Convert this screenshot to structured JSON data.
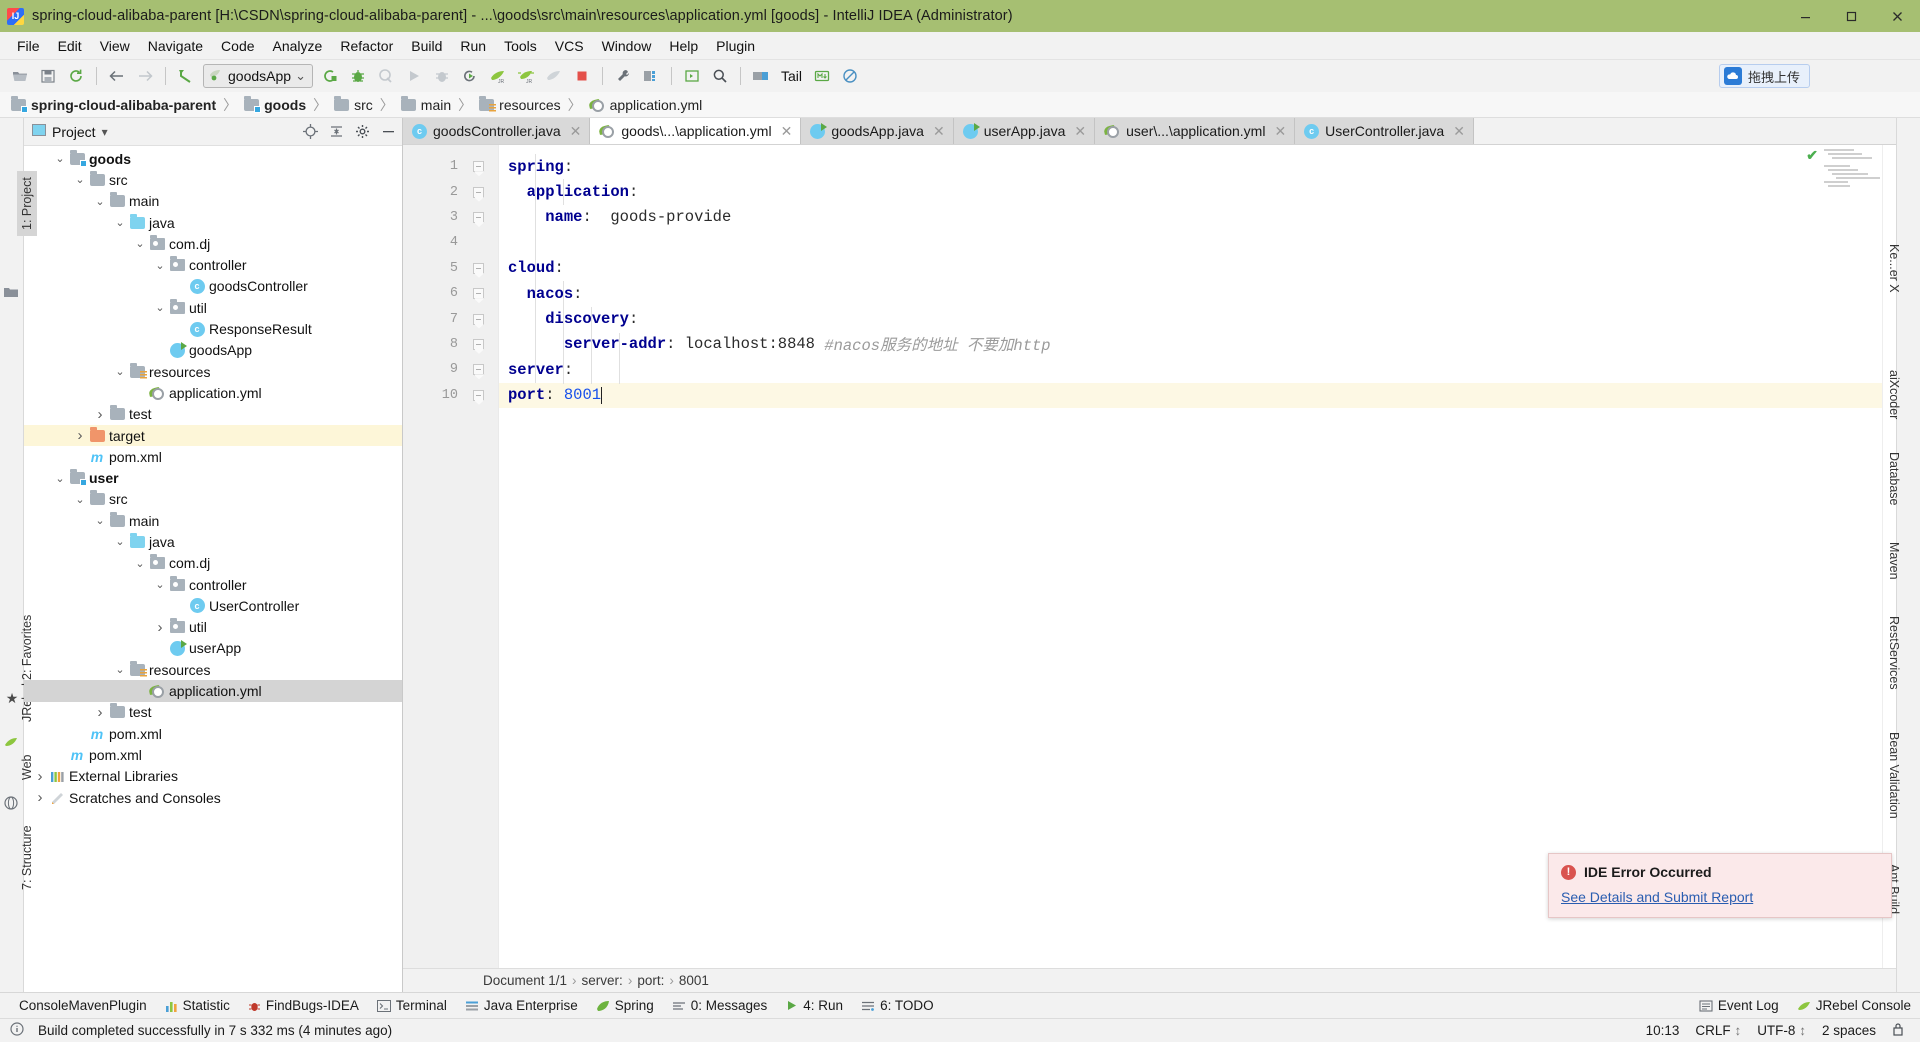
{
  "window": {
    "title": "spring-cloud-alibaba-parent [H:\\CSDN\\spring-cloud-alibaba-parent] - ...\\goods\\src\\main\\resources\\application.yml [goods] - IntelliJ IDEA (Administrator)",
    "app_icon": "intellij-idea-icon",
    "minimize_label": "─",
    "maximize_label": "❐",
    "close_label": "✕",
    "titlebar_color": "#a6bf72"
  },
  "menu": {
    "items": [
      {
        "label": "File"
      },
      {
        "label": "Edit"
      },
      {
        "label": "View"
      },
      {
        "label": "Navigate"
      },
      {
        "label": "Code"
      },
      {
        "label": "Analyze"
      },
      {
        "label": "Refactor"
      },
      {
        "label": "Build"
      },
      {
        "label": "Run"
      },
      {
        "label": "Tools"
      },
      {
        "label": "VCS"
      },
      {
        "label": "Window"
      },
      {
        "label": "Help"
      },
      {
        "label": "Plugin"
      }
    ]
  },
  "toolbar": {
    "icons": [
      "open-folder-icon",
      "save-all-icon",
      "sync-refresh-icon",
      "back-arrow-icon",
      "forward-arrow-icon",
      "undo-arrow-icon"
    ],
    "run_config": {
      "name": "goodsApp",
      "icon": "run-config-icon",
      "chevron": "⌄"
    },
    "run_icons": [
      "build-icon",
      "debug-bug-icon",
      "coverage-icon",
      "run-icon",
      "attach-icon",
      "run-with-coverage-icon",
      "jrebel-run-icon",
      "jrebel-debug-icon",
      "jrebel-idle-icon",
      "stop-icon"
    ],
    "right_icons": [
      "settings-wrench-icon",
      "project-structure-icon",
      "divider",
      "terminal-icon",
      "search-icon",
      "ide-icon"
    ],
    "tail_label": "Tail",
    "extra_icons": [
      "markdown-icon",
      "disable-icon"
    ],
    "upload": {
      "label": "拖拽上传",
      "icon": "upload-cloud-icon",
      "accent": "#2b7bd6"
    }
  },
  "breadcrumb": {
    "items": [
      {
        "label": "spring-cloud-alibaba-parent",
        "icon": "module-folder-icon",
        "bold": true
      },
      {
        "label": "goods",
        "icon": "module-folder-icon",
        "bold": true
      },
      {
        "label": "src",
        "icon": "folder-icon",
        "bold": false
      },
      {
        "label": "main",
        "icon": "folder-icon",
        "bold": false
      },
      {
        "label": "resources",
        "icon": "resources-folder-icon",
        "bold": false
      },
      {
        "label": "application.yml",
        "icon": "yaml-file-icon",
        "bold": false
      }
    ],
    "separator": "〉"
  },
  "left_rail": {
    "tabs": [
      {
        "label": "1: Project",
        "selected": true
      },
      {
        "label": "2: Favorites",
        "selected": false
      },
      {
        "label": "JRebel",
        "selected": false
      },
      {
        "label": "Web",
        "selected": false
      },
      {
        "label": "7: Structure",
        "selected": false
      }
    ]
  },
  "right_rail": {
    "tabs": [
      {
        "label": "Ke...er X"
      },
      {
        "label": "aiXcoder"
      },
      {
        "label": "Database"
      },
      {
        "label": "Maven"
      },
      {
        "label": "RestServices"
      },
      {
        "label": "Bean Validation"
      },
      {
        "label": "Ant Build"
      }
    ]
  },
  "project_panel": {
    "title": "Project",
    "chevron": "▾",
    "header_icons": [
      "locate-target-icon",
      "collapse-all-icon",
      "settings-gear-icon",
      "hide-panel-icon"
    ],
    "tree": [
      {
        "label": "goods",
        "depth": 1,
        "icon": "module-folder-icon",
        "arrow": "down",
        "bold": true,
        "state": "normal"
      },
      {
        "label": "src",
        "depth": 2,
        "icon": "folder-icon",
        "arrow": "down",
        "bold": false,
        "state": "normal"
      },
      {
        "label": "main",
        "depth": 3,
        "icon": "folder-icon",
        "arrow": "down",
        "bold": false,
        "state": "normal"
      },
      {
        "label": "java",
        "depth": 4,
        "icon": "source-folder-icon",
        "arrow": "down",
        "bold": false,
        "state": "normal"
      },
      {
        "label": "com.dj",
        "depth": 5,
        "icon": "package-icon",
        "arrow": "down",
        "bold": false,
        "state": "normal"
      },
      {
        "label": "controller",
        "depth": 6,
        "icon": "package-icon",
        "arrow": "down",
        "bold": false,
        "state": "normal"
      },
      {
        "label": "goodsController",
        "depth": 7,
        "icon": "java-class-icon",
        "arrow": "none",
        "bold": false,
        "state": "normal"
      },
      {
        "label": "util",
        "depth": 6,
        "icon": "package-icon",
        "arrow": "down",
        "bold": false,
        "state": "normal"
      },
      {
        "label": "ResponseResult",
        "depth": 7,
        "icon": "java-class-icon",
        "arrow": "none",
        "bold": false,
        "state": "normal"
      },
      {
        "label": "goodsApp",
        "depth": 6,
        "icon": "java-runnable-icon",
        "arrow": "none",
        "bold": false,
        "state": "normal"
      },
      {
        "label": "resources",
        "depth": 4,
        "icon": "resources-folder-icon",
        "arrow": "down",
        "bold": false,
        "state": "normal"
      },
      {
        "label": "application.yml",
        "depth": 5,
        "icon": "yaml-file-icon",
        "arrow": "none",
        "bold": false,
        "state": "normal"
      },
      {
        "label": "test",
        "depth": 3,
        "icon": "folder-icon",
        "arrow": "right",
        "bold": false,
        "state": "normal"
      },
      {
        "label": "target",
        "depth": 2,
        "icon": "excluded-folder-icon",
        "arrow": "right",
        "bold": false,
        "state": "highlight"
      },
      {
        "label": "pom.xml",
        "depth": 2,
        "icon": "maven-pom-icon",
        "arrow": "none",
        "bold": false,
        "state": "normal"
      },
      {
        "label": "user",
        "depth": 1,
        "icon": "module-folder-icon",
        "arrow": "down",
        "bold": true,
        "state": "normal"
      },
      {
        "label": "src",
        "depth": 2,
        "icon": "folder-icon",
        "arrow": "down",
        "bold": false,
        "state": "normal"
      },
      {
        "label": "main",
        "depth": 3,
        "icon": "folder-icon",
        "arrow": "down",
        "bold": false,
        "state": "normal"
      },
      {
        "label": "java",
        "depth": 4,
        "icon": "source-folder-icon",
        "arrow": "down",
        "bold": false,
        "state": "normal"
      },
      {
        "label": "com.dj",
        "depth": 5,
        "icon": "package-icon",
        "arrow": "down",
        "bold": false,
        "state": "normal"
      },
      {
        "label": "controller",
        "depth": 6,
        "icon": "package-icon",
        "arrow": "down",
        "bold": false,
        "state": "normal"
      },
      {
        "label": "UserController",
        "depth": 7,
        "icon": "java-class-icon",
        "arrow": "none",
        "bold": false,
        "state": "normal"
      },
      {
        "label": "util",
        "depth": 6,
        "icon": "package-icon",
        "arrow": "right",
        "bold": false,
        "state": "normal"
      },
      {
        "label": "userApp",
        "depth": 6,
        "icon": "java-runnable-icon",
        "arrow": "none",
        "bold": false,
        "state": "normal"
      },
      {
        "label": "resources",
        "depth": 4,
        "icon": "resources-folder-icon",
        "arrow": "down",
        "bold": false,
        "state": "normal"
      },
      {
        "label": "application.yml",
        "depth": 5,
        "icon": "yaml-file-icon",
        "arrow": "none",
        "bold": false,
        "state": "selected"
      },
      {
        "label": "test",
        "depth": 3,
        "icon": "folder-icon",
        "arrow": "right",
        "bold": false,
        "state": "normal"
      },
      {
        "label": "pom.xml",
        "depth": 2,
        "icon": "maven-pom-icon",
        "arrow": "none",
        "bold": false,
        "state": "normal"
      },
      {
        "label": "pom.xml",
        "depth": 1,
        "icon": "maven-pom-icon",
        "arrow": "none",
        "bold": false,
        "state": "normal"
      },
      {
        "label": "External Libraries",
        "depth": 0,
        "icon": "libraries-icon",
        "arrow": "right",
        "bold": false,
        "state": "normal"
      },
      {
        "label": "Scratches and Consoles",
        "depth": 0,
        "icon": "scratches-icon",
        "arrow": "right",
        "bold": false,
        "state": "normal"
      }
    ]
  },
  "editor_tabs": [
    {
      "label": "goodsController.java",
      "icon": "java-class-icon",
      "active": false,
      "close": "✕"
    },
    {
      "label": "goods\\...\\application.yml",
      "icon": "yaml-file-icon",
      "active": true,
      "close": "✕"
    },
    {
      "label": "goodsApp.java",
      "icon": "java-runnable-icon",
      "active": false,
      "close": "✕"
    },
    {
      "label": "userApp.java",
      "icon": "java-runnable-icon",
      "active": false,
      "close": "✕"
    },
    {
      "label": "user\\...\\application.yml",
      "icon": "yaml-file-icon",
      "active": false,
      "close": "✕"
    },
    {
      "label": "UserController.java",
      "icon": "java-class-icon",
      "active": false,
      "close": "✕"
    }
  ],
  "editor": {
    "current_line": 10,
    "lines": [
      {
        "n": 1,
        "indent": 0,
        "fold": true,
        "tokens": [
          {
            "t": "spring",
            "c": "k"
          },
          {
            "t": ":",
            "c": "p"
          }
        ]
      },
      {
        "n": 2,
        "indent": 1,
        "fold": true,
        "tokens": [
          {
            "t": "application",
            "c": "k"
          },
          {
            "t": ":",
            "c": "p"
          }
        ]
      },
      {
        "n": 3,
        "indent": 2,
        "fold": true,
        "tokens": [
          {
            "t": "name",
            "c": "k"
          },
          {
            "t": ":",
            "c": "p"
          },
          {
            "t": "  goods-provide",
            "c": "v"
          }
        ]
      },
      {
        "n": 4,
        "indent": 0,
        "fold": false,
        "tokens": []
      },
      {
        "n": 5,
        "indent": 0,
        "fold": true,
        "tokens": [
          {
            "t": "cloud",
            "c": "k"
          },
          {
            "t": ":",
            "c": "p"
          }
        ]
      },
      {
        "n": 6,
        "indent": 1,
        "fold": true,
        "tokens": [
          {
            "t": "nacos",
            "c": "k"
          },
          {
            "t": ":",
            "c": "p"
          }
        ]
      },
      {
        "n": 7,
        "indent": 2,
        "fold": true,
        "tokens": [
          {
            "t": "discovery",
            "c": "k"
          },
          {
            "t": ":",
            "c": "p"
          }
        ]
      },
      {
        "n": 8,
        "indent": 3,
        "fold": true,
        "tokens": [
          {
            "t": "server-addr",
            "c": "k"
          },
          {
            "t": ":",
            "c": "p"
          },
          {
            "t": " localhost:8848 ",
            "c": "v"
          },
          {
            "t": "#nacos服务的地址 不要加http",
            "c": "cmt"
          }
        ]
      },
      {
        "n": 9,
        "indent": -1,
        "fold": true,
        "tokens": [
          {
            "t": "server",
            "c": "k"
          },
          {
            "t": ":",
            "c": "p"
          }
        ]
      },
      {
        "n": 10,
        "indent": 0,
        "fold": true,
        "tokens": [
          {
            "t": "port",
            "c": "k"
          },
          {
            "t": ":",
            "c": "p"
          },
          {
            "t": " ",
            "c": "v"
          },
          {
            "t": "8001",
            "c": "num"
          }
        ]
      }
    ],
    "inspection_status": "ok-check-icon"
  },
  "doc_breadcrumb": {
    "document": "Document 1/1",
    "path": [
      "server:",
      "port:",
      "8001"
    ],
    "separator": "›"
  },
  "notification": {
    "icon": "error-icon",
    "title": "IDE Error Occurred",
    "link": "See Details and Submit Report"
  },
  "bottom_tools": [
    {
      "label": "ConsoleMavenPlugin",
      "icon": "none"
    },
    {
      "label": "Statistic",
      "icon": "statistic-icon"
    },
    {
      "label": "FindBugs-IDEA",
      "icon": "findbugs-icon"
    },
    {
      "label": "Terminal",
      "icon": "terminal-icon"
    },
    {
      "label": "Java Enterprise",
      "icon": "java-enterprise-icon"
    },
    {
      "label": "Spring",
      "icon": "spring-leaf-icon"
    },
    {
      "label": "0: Messages",
      "icon": "messages-icon",
      "mnemonic": "0"
    },
    {
      "label": "4: Run",
      "icon": "run-icon",
      "mnemonic": "4"
    },
    {
      "label": "6: TODO",
      "icon": "todo-icon",
      "mnemonic": "6"
    }
  ],
  "bottom_tools_right": [
    {
      "label": "Event Log",
      "icon": "event-log-icon"
    },
    {
      "label": "JRebel Console",
      "icon": "jrebel-icon"
    }
  ],
  "status_bar": {
    "icon": "info-icon",
    "message": "Build completed successfully in 7 s 332 ms (4 minutes ago)",
    "position": "10:13",
    "line_separator": "CRLF",
    "line_separator_chevron": "↕",
    "encoding": "UTF-8",
    "encoding_chevron": "↕",
    "indent": "2 spaces",
    "lock_icon": "lock-icon"
  }
}
